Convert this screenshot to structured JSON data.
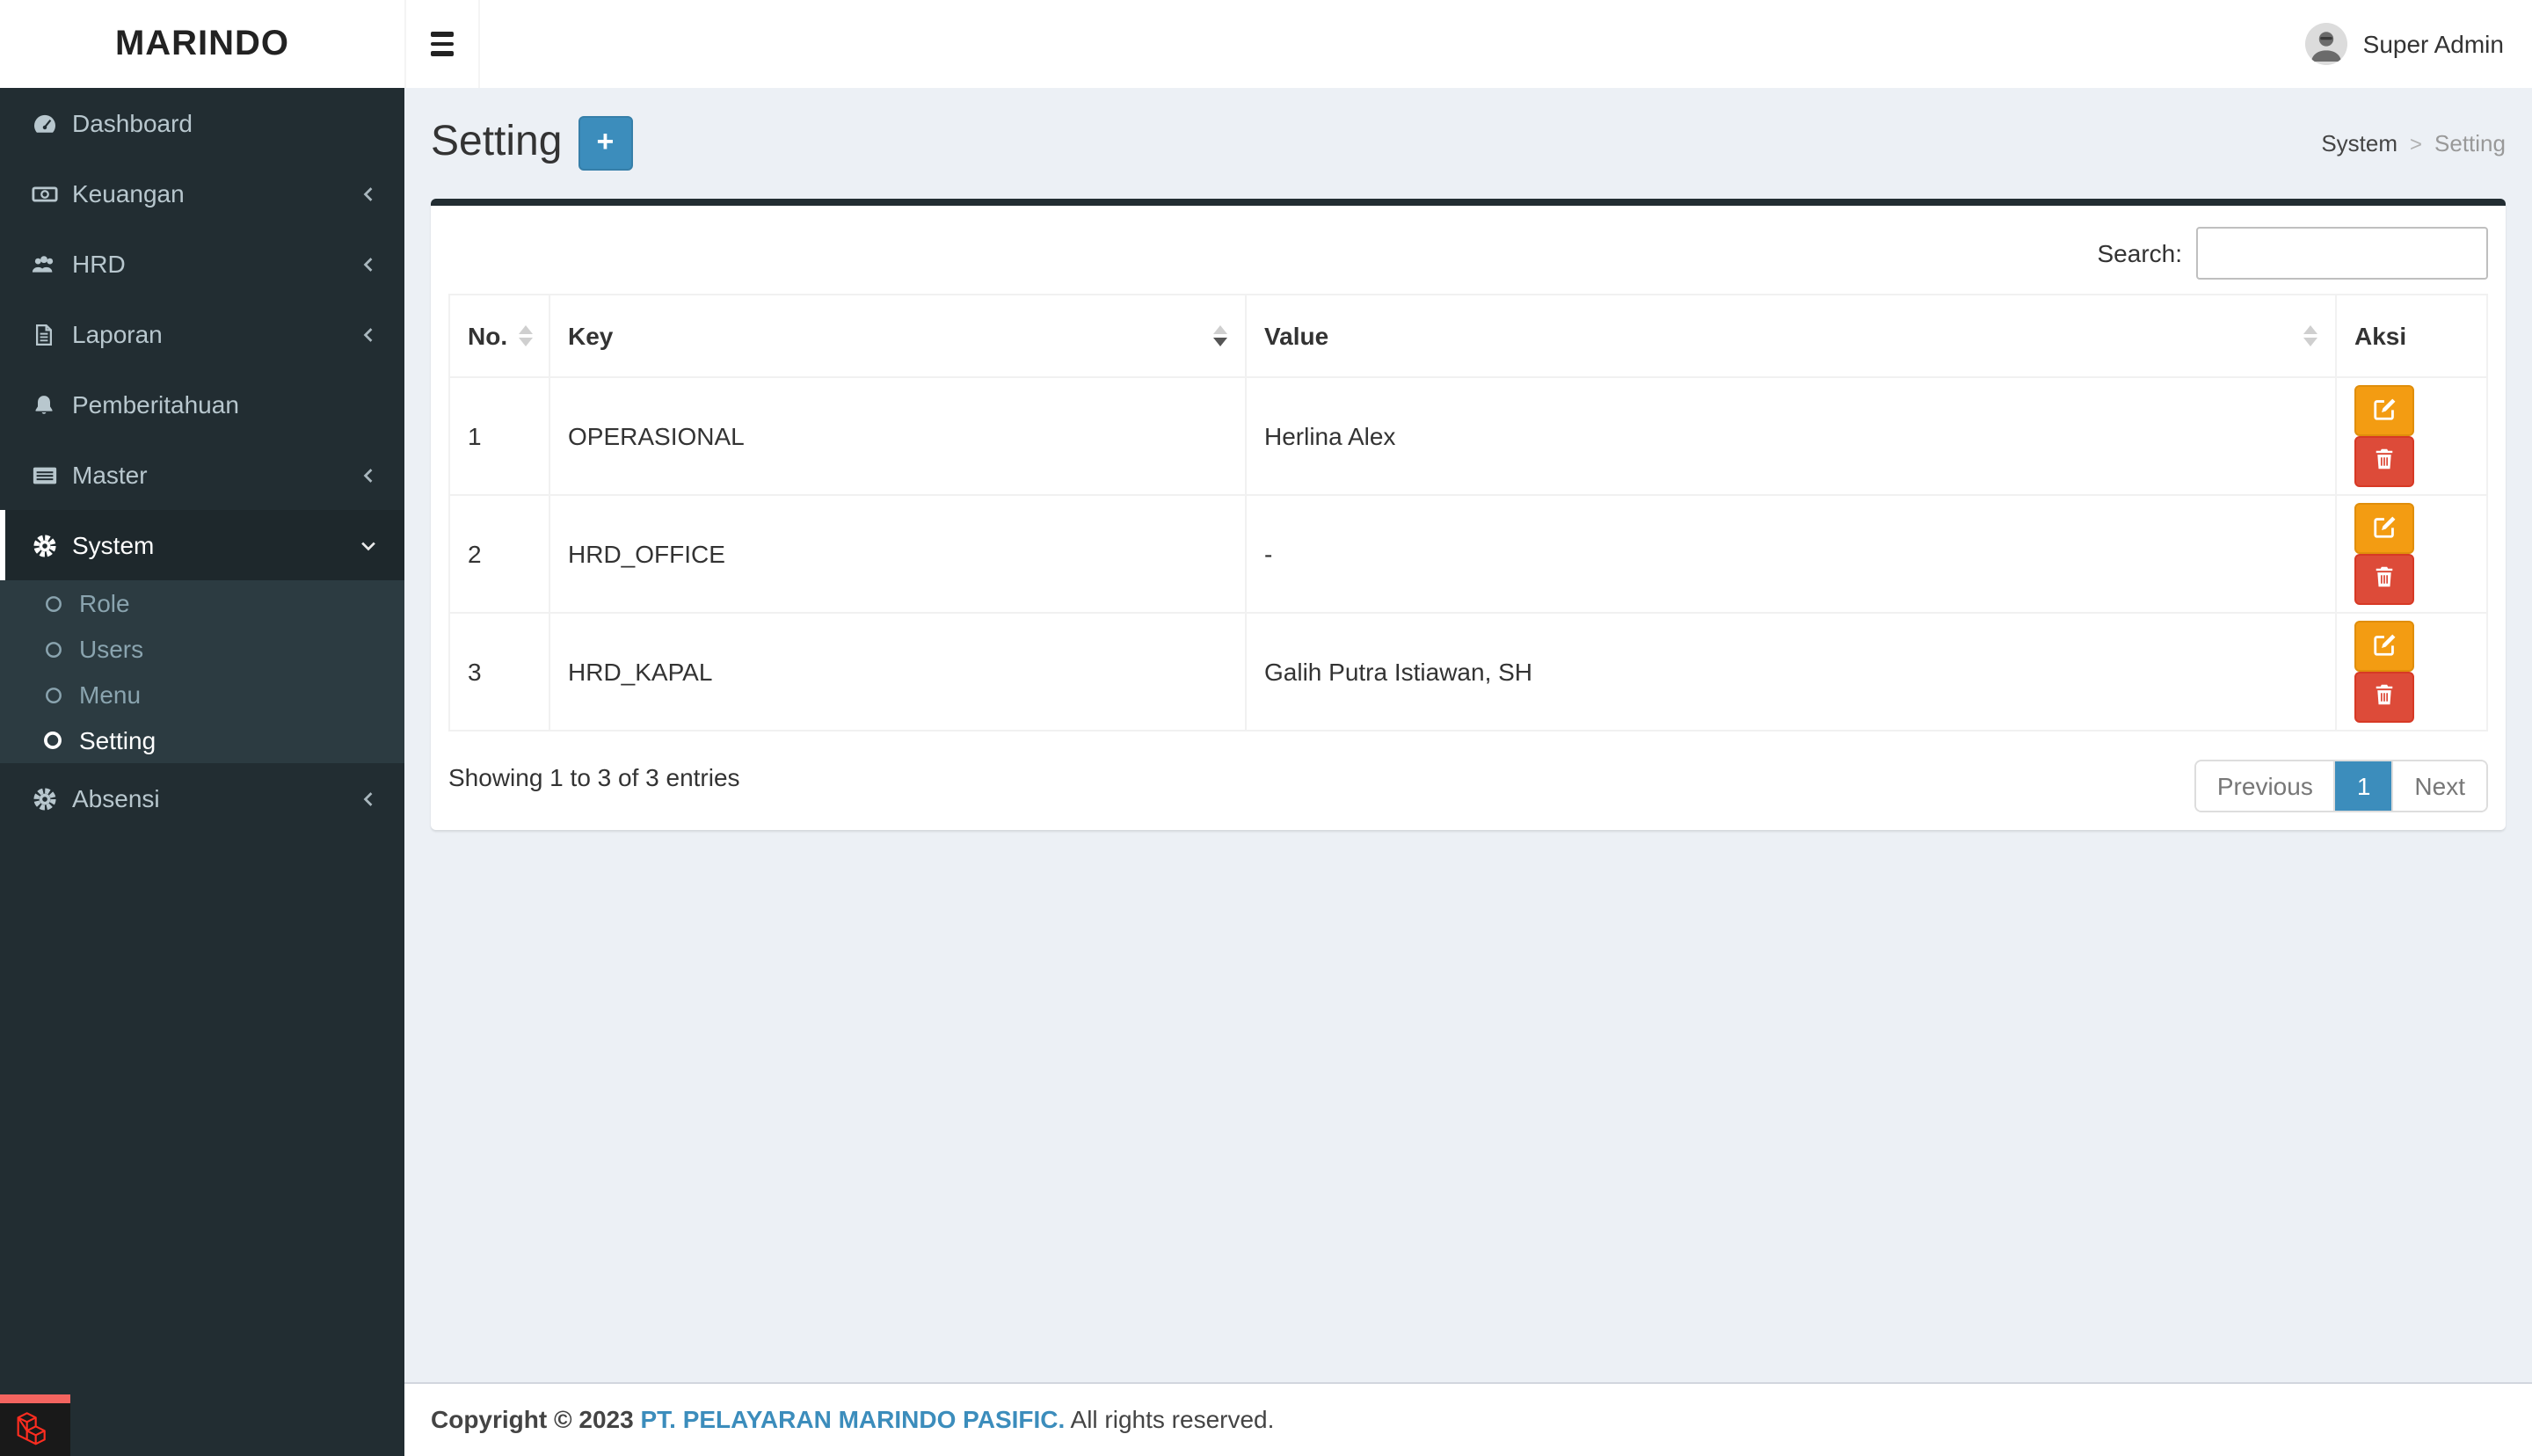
{
  "header": {
    "logo": "MARINDO",
    "user": "Super Admin"
  },
  "sidebar": {
    "items": [
      {
        "label": "Dashboard",
        "icon": "tachometer-icon",
        "chevron": null
      },
      {
        "label": "Keuangan",
        "icon": "money-icon",
        "chevron": "left"
      },
      {
        "label": "HRD",
        "icon": "users-icon",
        "chevron": "left"
      },
      {
        "label": "Laporan",
        "icon": "file-text-icon",
        "chevron": "left"
      },
      {
        "label": "Pemberitahuan",
        "icon": "bell-icon",
        "chevron": null
      },
      {
        "label": "Master",
        "icon": "list-icon",
        "chevron": "left"
      },
      {
        "label": "System",
        "icon": "gear-icon",
        "chevron": "down",
        "active": true
      },
      {
        "label": "Absensi",
        "icon": "gear-icon",
        "chevron": "left"
      }
    ],
    "system_children": [
      {
        "label": "Role",
        "icon": "circle-o-icon"
      },
      {
        "label": "Users",
        "icon": "circle-o-icon"
      },
      {
        "label": "Menu",
        "icon": "circle-o-icon"
      },
      {
        "label": "Setting",
        "icon": "circle-o-icon",
        "active": true
      }
    ]
  },
  "page": {
    "title": "Setting",
    "add_button": "+",
    "breadcrumb": {
      "parent": "System",
      "separator": ">",
      "current": "Setting"
    }
  },
  "table": {
    "search_label": "Search:",
    "search_value": "",
    "headers": {
      "no": "No.",
      "key": "Key",
      "value": "Value",
      "aksi": "Aksi"
    },
    "sort_state": {
      "column": "Key",
      "direction": "descending"
    },
    "rows": [
      {
        "no": "1",
        "key": "OPERASIONAL",
        "value": "Herlina Alex"
      },
      {
        "no": "2",
        "key": "HRD_OFFICE",
        "value": "-"
      },
      {
        "no": "3",
        "key": "HRD_KAPAL",
        "value": "Galih Putra Istiawan, SH"
      }
    ],
    "actions": {
      "edit": "edit-pencil-square-icon",
      "delete": "trash-icon"
    },
    "info": "Showing 1 to 3 of 3 entries",
    "pagination": {
      "previous": "Previous",
      "page": "1",
      "next": "Next"
    }
  },
  "footer": {
    "copyright": "Copyright © 2023",
    "company": "PT. PELAYARAN MARINDO PASIFIC.",
    "rights": "All rights reserved."
  },
  "icons": {
    "hamburger-icon": "three-bars",
    "tachometer-icon": "filled gauge with needle",
    "money-icon": "banknote outline with circle",
    "users-icon": "group of three people",
    "file-text-icon": "document outline with lines",
    "bell-icon": "filled bell",
    "list-icon": "filled box with rows",
    "gear-icon": "cog wheel",
    "circle-o-icon": "ring outline",
    "chevron-left-icon": "‹",
    "chevron-down-icon": "⌄",
    "plus-icon": "+",
    "edit-pencil-square-icon": "pencil over square",
    "trash-icon": "trash can",
    "laravel-logo-icon": "red isometric cube outline",
    "avatar": "grayscale user photo"
  },
  "colors": {
    "primary": "#3c8dbc",
    "warning": "#f39c12",
    "danger": "#dd4b39",
    "sidebar_bg": "#222d32",
    "submenu_bg": "#2c3b41",
    "content_bg": "#ecf0f5",
    "debugbar_red": "#f4645f"
  }
}
